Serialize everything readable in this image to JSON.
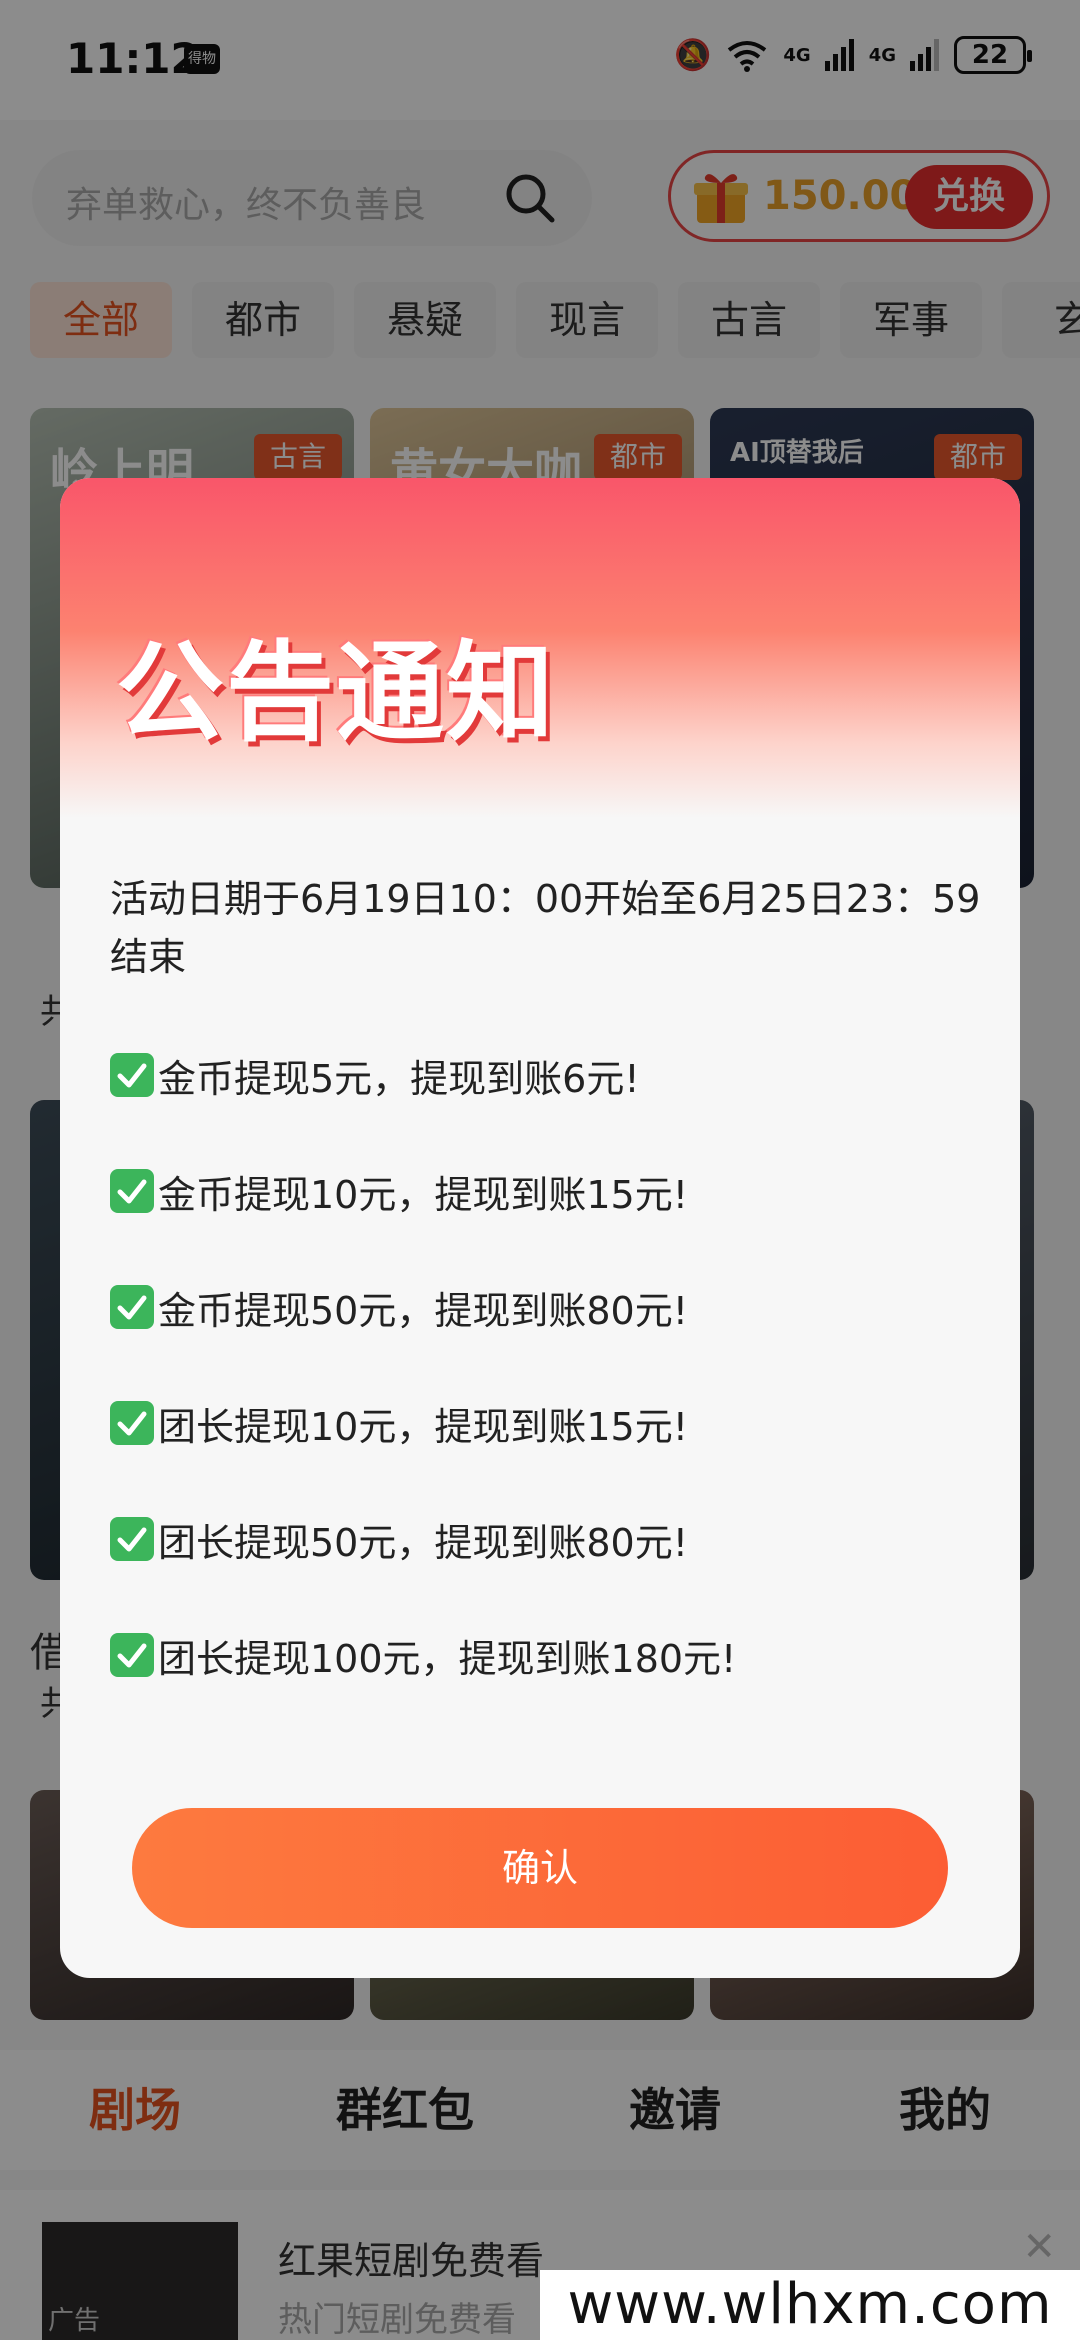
{
  "status_bar": {
    "time": "11:12",
    "app_icon_text": "得物",
    "network_1": "4G",
    "network_2": "4G",
    "battery": "22"
  },
  "search": {
    "placeholder": "弃单救心，终不负善良"
  },
  "coins": {
    "value": "150.00",
    "exchange_label": "兑换"
  },
  "categories": [
    "全部",
    "都市",
    "悬疑",
    "现言",
    "古言",
    "军事",
    "玄"
  ],
  "cards": [
    {
      "title": "岭上明",
      "tag": "古言"
    },
    {
      "title": "黄女大咖",
      "tag": "都市"
    },
    {
      "title": "AI顶替我后",
      "tag": "都市"
    }
  ],
  "side_texts": {
    "row1_prefix": "共",
    "row2_title": "借",
    "row2_prefix": "共"
  },
  "bottom_nav": [
    "剧场",
    "群红包",
    "邀请",
    "我的"
  ],
  "ad": {
    "title": "红果短剧免费看",
    "subtitle": "热门短剧免费看",
    "label": "广告"
  },
  "modal": {
    "title": "公告通知",
    "date_text": "活动日期于6月19日10：00开始至6月25日23：59结束",
    "rules": [
      "金币提现5元，提现到账6元!",
      "金币提现10元，提现到账15元!",
      "金币提现50元，提现到账80元!",
      "团长提现10元，提现到账15元!",
      "团长提现50元，提现到账80元!",
      "团长提现100元，提现到账180元!"
    ],
    "confirm_label": "确认"
  },
  "watermark": "www.wlhxm.com",
  "colors": {
    "accent": "#e5531f",
    "confirm": "#fc5d34",
    "header_top": "#f9566a",
    "check": "#3cb55b"
  }
}
